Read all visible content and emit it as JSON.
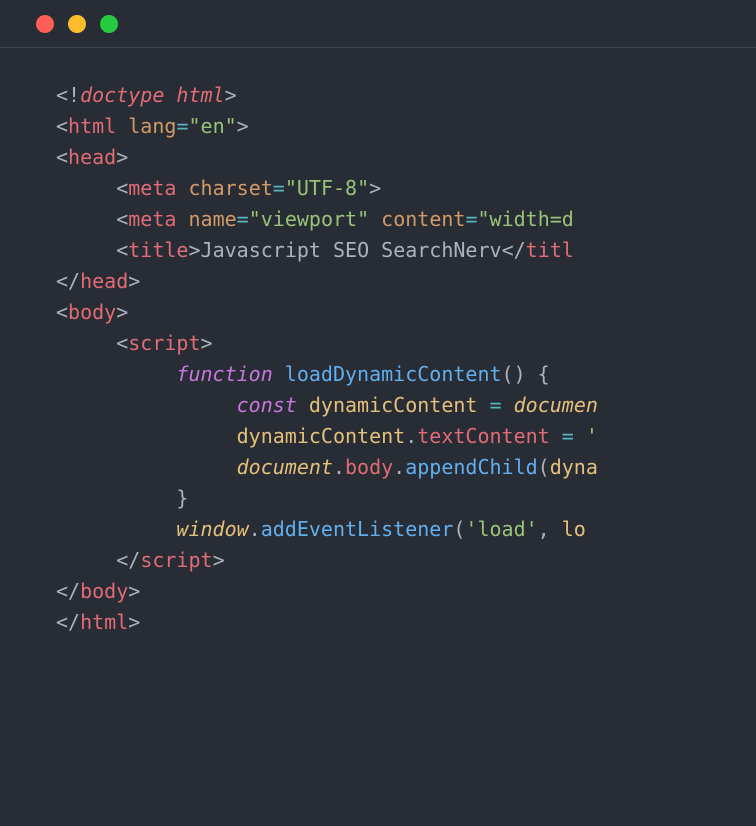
{
  "titlebar": {
    "lights": [
      "red",
      "yellow",
      "green"
    ]
  },
  "code": {
    "lines": [
      {
        "indent": 0,
        "tokens": [
          {
            "class": "c-bracket",
            "text": "<!"
          },
          {
            "class": "c-tag italic",
            "text": "doctype html"
          },
          {
            "class": "c-bracket",
            "text": ">"
          }
        ]
      },
      {
        "indent": 0,
        "tokens": [
          {
            "class": "c-bracket",
            "text": "<"
          },
          {
            "class": "c-tag",
            "text": "html"
          },
          {
            "class": "c-plain",
            "text": " "
          },
          {
            "class": "c-attr",
            "text": "lang"
          },
          {
            "class": "c-op",
            "text": "="
          },
          {
            "class": "c-string",
            "text": "\"en\""
          },
          {
            "class": "c-bracket",
            "text": ">"
          }
        ]
      },
      {
        "indent": 0,
        "tokens": [
          {
            "class": "c-bracket",
            "text": "<"
          },
          {
            "class": "c-tag",
            "text": "head"
          },
          {
            "class": "c-bracket",
            "text": ">"
          }
        ]
      },
      {
        "indent": 1,
        "tokens": [
          {
            "class": "c-bracket",
            "text": "<"
          },
          {
            "class": "c-tag",
            "text": "meta"
          },
          {
            "class": "c-plain",
            "text": " "
          },
          {
            "class": "c-attr",
            "text": "charset"
          },
          {
            "class": "c-op",
            "text": "="
          },
          {
            "class": "c-string",
            "text": "\"UTF-8\""
          },
          {
            "class": "c-bracket",
            "text": ">"
          }
        ]
      },
      {
        "indent": 1,
        "tokens": [
          {
            "class": "c-bracket",
            "text": "<"
          },
          {
            "class": "c-tag",
            "text": "meta"
          },
          {
            "class": "c-plain",
            "text": " "
          },
          {
            "class": "c-attr",
            "text": "name"
          },
          {
            "class": "c-op",
            "text": "="
          },
          {
            "class": "c-string",
            "text": "\"viewport\""
          },
          {
            "class": "c-plain",
            "text": " "
          },
          {
            "class": "c-attr",
            "text": "content"
          },
          {
            "class": "c-op",
            "text": "="
          },
          {
            "class": "c-string",
            "text": "\"width=d"
          }
        ]
      },
      {
        "indent": 1,
        "tokens": [
          {
            "class": "c-bracket",
            "text": "<"
          },
          {
            "class": "c-tag",
            "text": "title"
          },
          {
            "class": "c-bracket",
            "text": ">"
          },
          {
            "class": "c-text",
            "text": "Javascript SEO SearchNerv"
          },
          {
            "class": "c-bracket",
            "text": "</"
          },
          {
            "class": "c-tag",
            "text": "titl"
          }
        ]
      },
      {
        "indent": 0,
        "tokens": [
          {
            "class": "c-bracket",
            "text": "</"
          },
          {
            "class": "c-tag",
            "text": "head"
          },
          {
            "class": "c-bracket",
            "text": ">"
          }
        ]
      },
      {
        "indent": 0,
        "tokens": [
          {
            "class": "c-bracket",
            "text": "<"
          },
          {
            "class": "c-tag",
            "text": "body"
          },
          {
            "class": "c-bracket",
            "text": ">"
          }
        ]
      },
      {
        "indent": 1,
        "tokens": [
          {
            "class": "c-bracket",
            "text": "<"
          },
          {
            "class": "c-tag",
            "text": "script"
          },
          {
            "class": "c-bracket",
            "text": ">"
          }
        ]
      },
      {
        "indent": 2,
        "tokens": [
          {
            "class": "c-keyword",
            "text": "function"
          },
          {
            "class": "c-plain",
            "text": " "
          },
          {
            "class": "c-func",
            "text": "loadDynamicContent"
          },
          {
            "class": "c-plain",
            "text": "() {"
          }
        ]
      },
      {
        "indent": 3,
        "tokens": [
          {
            "class": "c-keyword",
            "text": "const"
          },
          {
            "class": "c-plain",
            "text": " "
          },
          {
            "class": "c-var",
            "text": "dynamicContent"
          },
          {
            "class": "c-plain",
            "text": " "
          },
          {
            "class": "c-op",
            "text": "="
          },
          {
            "class": "c-plain",
            "text": " "
          },
          {
            "class": "c-obj-italic",
            "text": "documen"
          }
        ]
      },
      {
        "indent": 3,
        "tokens": [
          {
            "class": "c-var",
            "text": "dynamicContent"
          },
          {
            "class": "c-plain",
            "text": "."
          },
          {
            "class": "c-tag",
            "text": "textContent"
          },
          {
            "class": "c-plain",
            "text": " "
          },
          {
            "class": "c-op",
            "text": "="
          },
          {
            "class": "c-plain",
            "text": " "
          },
          {
            "class": "c-string",
            "text": "'"
          }
        ]
      },
      {
        "indent": 3,
        "tokens": [
          {
            "class": "c-obj-italic",
            "text": "document"
          },
          {
            "class": "c-plain",
            "text": "."
          },
          {
            "class": "c-tag",
            "text": "body"
          },
          {
            "class": "c-plain",
            "text": "."
          },
          {
            "class": "c-func",
            "text": "appendChild"
          },
          {
            "class": "c-plain",
            "text": "("
          },
          {
            "class": "c-var",
            "text": "dyna"
          }
        ]
      },
      {
        "indent": 2,
        "tokens": [
          {
            "class": "c-plain",
            "text": "}"
          }
        ]
      },
      {
        "indent": 2,
        "tokens": [
          {
            "class": "c-obj-italic",
            "text": "window"
          },
          {
            "class": "c-plain",
            "text": "."
          },
          {
            "class": "c-func",
            "text": "addEventListener"
          },
          {
            "class": "c-plain",
            "text": "("
          },
          {
            "class": "c-string",
            "text": "'load'"
          },
          {
            "class": "c-plain",
            "text": ", "
          },
          {
            "class": "c-var",
            "text": "lo"
          }
        ]
      },
      {
        "indent": 1,
        "tokens": [
          {
            "class": "c-bracket",
            "text": "</"
          },
          {
            "class": "c-tag",
            "text": "script"
          },
          {
            "class": "c-bracket",
            "text": ">"
          }
        ]
      },
      {
        "indent": 0,
        "tokens": [
          {
            "class": "c-bracket",
            "text": "</"
          },
          {
            "class": "c-tag",
            "text": "body"
          },
          {
            "class": "c-bracket",
            "text": ">"
          }
        ]
      },
      {
        "indent": 0,
        "tokens": [
          {
            "class": "c-bracket",
            "text": "</"
          },
          {
            "class": "c-tag",
            "text": "html"
          },
          {
            "class": "c-bracket",
            "text": ">"
          }
        ]
      }
    ]
  }
}
